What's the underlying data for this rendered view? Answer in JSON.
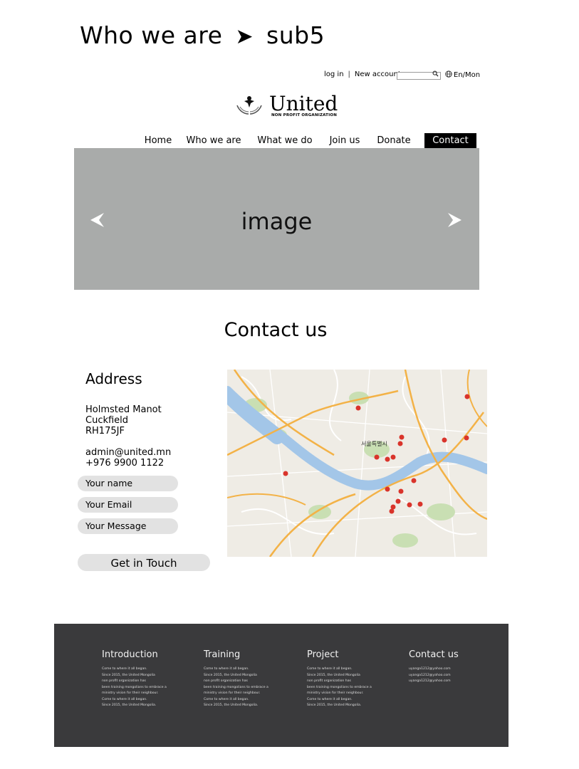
{
  "page_title": {
    "section": "Who we are",
    "arrow_glyph": "➤",
    "sub": "sub5"
  },
  "top_bar": {
    "login": "log in",
    "separator": "|",
    "new_account": "New account",
    "search_placeholder": "",
    "lang": "En/Mon"
  },
  "logo": {
    "name": "United",
    "tagline": "NON PROFIT ORGANIZATION"
  },
  "nav": [
    {
      "label": "Home",
      "active": false
    },
    {
      "label": "Who we are",
      "active": false
    },
    {
      "label": "What we do",
      "active": false
    },
    {
      "label": "Join us",
      "active": false
    },
    {
      "label": "Donate",
      "active": false
    },
    {
      "label": "Contact",
      "active": true
    }
  ],
  "hero": {
    "label": "image"
  },
  "contact": {
    "title": "Contact us",
    "address_title": "Address",
    "address_lines": [
      "Holmsted Manot",
      "Cuckfield",
      "RH175JF"
    ],
    "email": "admin@united.mn",
    "phone": "+976 9900 1122",
    "fields": {
      "name": "Your name",
      "email": "Your Email",
      "message": "Your Message"
    },
    "submit": "Get in Touch"
  },
  "map": {
    "city_label": "서울특별시"
  },
  "footer": {
    "columns": [
      {
        "title": "Introduction",
        "lines": [
          "Come to where it all began.",
          "Since 2015, the United Mongolia",
          "non profit organization has",
          "been training mongolians to embrace a",
          "ministry vision for their neighbour.",
          "Come to where it all began.",
          "Since 2015, the United Mongolia."
        ]
      },
      {
        "title": "Training",
        "lines": [
          "Come to where it all began.",
          "Since 2015, the United Mongolia",
          "non profit organization has",
          "been training mongolians to embrace a",
          "ministry vision for their neighbour.",
          "Come to where it all began.",
          "Since 2015, the United Mongolia."
        ]
      },
      {
        "title": "Project",
        "lines": [
          "Come to where it all began.",
          "Since 2015, the United Mongolia",
          "non profit organization has",
          "been training mongolians to embrace a",
          "ministry vision for their neighbour.",
          "Come to where it all began.",
          "Since 2015, the United Mongolia."
        ]
      },
      {
        "title": "Contact us",
        "lines": [
          "uyanga1212@yahoo.com",
          "uyanga1212@yahoo.com",
          "uyanga1212@yahoo.com"
        ]
      }
    ]
  },
  "colors": {
    "hero_bg": "#a9abaa",
    "footer_bg": "#3a3a3c",
    "field_bg": "#e2e2e2",
    "river": "#a3c6e8",
    "road": "#f3b247",
    "marker": "#d9342b"
  }
}
